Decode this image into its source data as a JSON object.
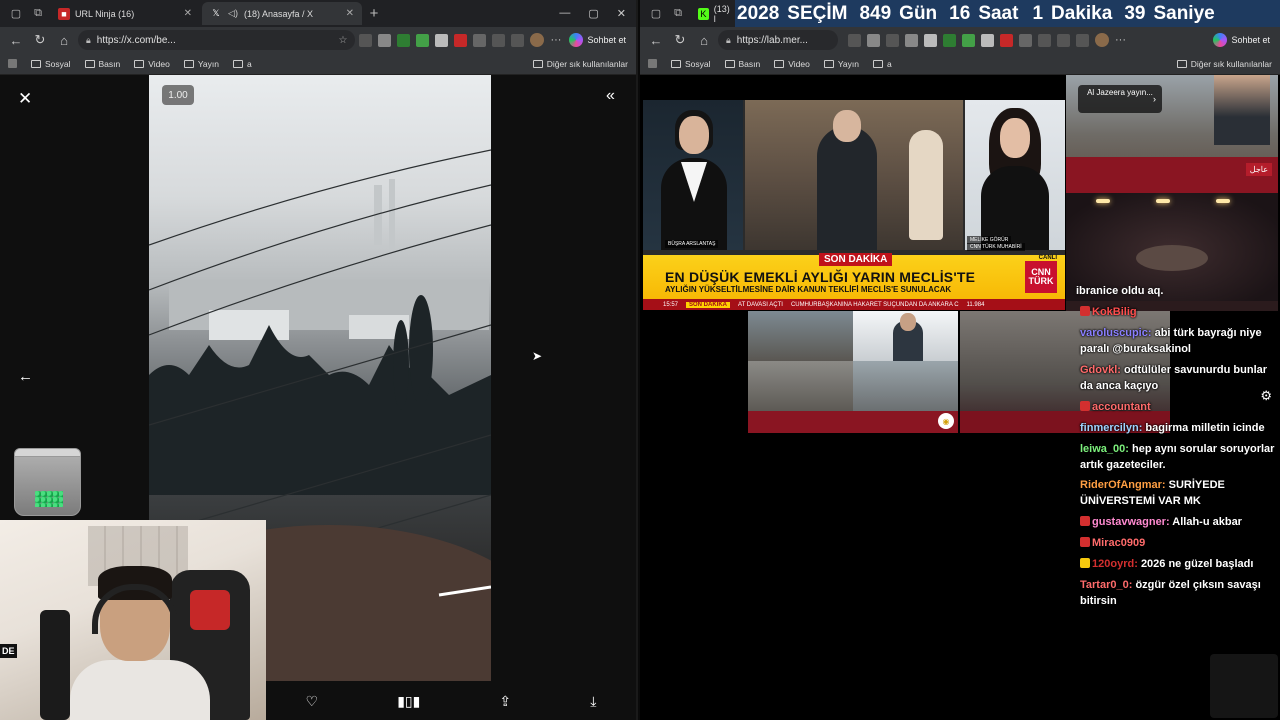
{
  "left_window": {
    "tabs": [
      {
        "label": "URL Ninja (16)",
        "active": false
      },
      {
        "label": "(18) Anasayfa / X",
        "active": true
      }
    ],
    "url": "https://x.com/be...",
    "copilot_label": "Sohbet et",
    "bookmarks": [
      "Sosyal",
      "Basın",
      "Video",
      "Yayın",
      "a"
    ],
    "bookmarks_other": "Diğer sık kullanılanlar",
    "speed_label": "1.00"
  },
  "right_window": {
    "tab_label": "(13) l",
    "url": "https://lab.mer...",
    "copilot_label": "Sohbet et",
    "bookmarks": [
      "Sosyal",
      "Basın",
      "Video",
      "Yayın",
      "a"
    ],
    "bookmarks_other": "Diğer sık kullanılanlar"
  },
  "countdown": {
    "year": "2028",
    "label": "SEÇİM",
    "days": "849",
    "days_label": "Gün",
    "hours": "16",
    "hours_label": "Saat",
    "minutes": "1",
    "minutes_label": "Dakika",
    "seconds": "39",
    "seconds_label": "Saniye"
  },
  "news": {
    "anchor_left_name": "BÜŞRA ARSLANTAŞ",
    "anchor_right_name": "MELİKE GÖRÜR",
    "anchor_right_role": "CNN TÜRK MUHABİRİ",
    "breaking_tag": "SON DAKİKA",
    "headline": "EN DÜŞÜK EMEKLİ AYLIĞI YARIN MECLİS'TE",
    "subheadline": "AYLIĞIN YÜKSELTİLMESİNE DAİR KANUN TEKLİFİ MECLİS'E SUNULACAK",
    "live_label": "CANLI",
    "channel": "CNN TÜRK",
    "crawl_time": "15:57",
    "crawl_tag": "SON DAKİKA",
    "crawl_items": [
      "AT DAVASI AÇTI",
      "CUMHURBAŞKANINA HAKARET SUÇUNDAN DA ANKARA C",
      "11.984"
    ]
  },
  "aljazeera": {
    "bubble": "Al Jazeera yayın...",
    "urgent": "عاجل",
    "room_caption": "ibranice oldu aq."
  },
  "chat": [
    {
      "user": "KokBilig",
      "text": "",
      "color": "#ff4d4d",
      "badge": "#d32f2f"
    },
    {
      "user": "varoluscupic",
      "text": "abi türk bayrağı niye paralı @buraksakinol",
      "color": "#8a7fff",
      "badge": ""
    },
    {
      "user": "Gdovkl",
      "text": "odtülüler savunurdu bunlar da anca kaçıyo",
      "color": "#ff6b6b",
      "badge": ""
    },
    {
      "user": "accountant",
      "text": "",
      "color": "#ff6b6b",
      "badge": "#d32f2f"
    },
    {
      "user": "finmercilyn",
      "text": "bagirma milletin icinde",
      "color": "#9fd3ff",
      "badge": ""
    },
    {
      "user": "leiwa_00",
      "text": "hep aynı sorular soruyorlar artık gazeteciler.",
      "color": "#7cf07c",
      "badge": ""
    },
    {
      "user": "RiderOfAngmar",
      "text": "SURİYEDE ÜNİVERSTEMİ VAR MK",
      "color": "#ff9f43",
      "badge": ""
    },
    {
      "user": "gustavwagner",
      "text": "Allah-u akbar",
      "color": "#ff8ad0",
      "badge": "#d32f2f"
    },
    {
      "user": "Mirac0909",
      "text": "",
      "color": "#ff6b6b",
      "badge": "#d32f2f"
    },
    {
      "user": "120oyrd",
      "text": "2026 ne güzel başladı",
      "color": "#d32f2f",
      "badge": "#f6c90e"
    },
    {
      "user": "Tartar0_0",
      "text": "özgür özel çıksın savaşı bitirsin",
      "color": "#ff6b6b",
      "badge": ""
    }
  ],
  "colors": {
    "browser_bg": "#333538",
    "countdown_bg": "#1e3a5f",
    "cnn_red": "#c8102e",
    "ticker_yellow": "#fbd11a"
  },
  "icons": {
    "action_bar": [
      "heart-icon",
      "stats-icon",
      "share-icon",
      "download-icon"
    ]
  }
}
